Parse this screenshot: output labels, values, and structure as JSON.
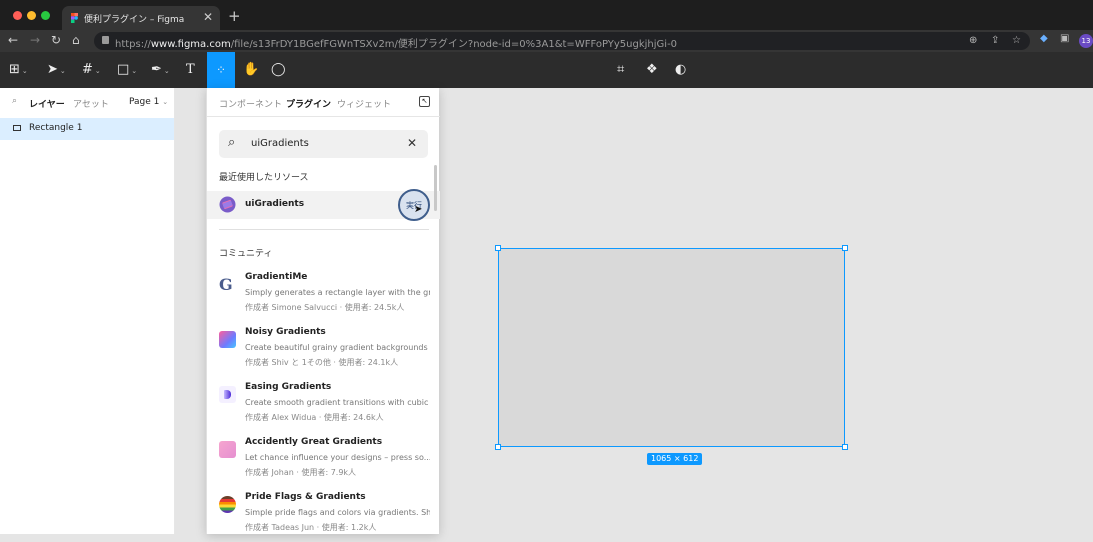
{
  "browser": {
    "tab_title": "便利プラグイン – Figma",
    "new_tab": "+",
    "tab_close": "✕",
    "url_prefix": "https://",
    "url_host": "www.figma.com",
    "url_path": "/file/s13FrDY1BGefFGWnTSXv2m/便利プラグイン?node-id=0%3A1&t=WFFoPYy5ugkjhjGi-0",
    "extension_badge": "13"
  },
  "toolbar": {
    "text_tool": "T"
  },
  "left_panel": {
    "tabs": [
      "レイヤー",
      "アセット"
    ],
    "page_selector": "Page 1",
    "layers": [
      {
        "name": "Rectangle 1"
      }
    ]
  },
  "resources": {
    "tabs": [
      "コンポーネント",
      "プラグイン",
      "ウィジェット"
    ],
    "active_tab": "プラグイン",
    "search_value": "uiGradients",
    "recent_heading": "最近使用したリソース",
    "recent_item": {
      "name": "uiGradients",
      "run_label": "実行"
    },
    "community_heading": "コミュニティ",
    "plugins": [
      {
        "name": "GradientiMe",
        "description": "Simply generates a rectangle layer with the gr...",
        "author": "作成者 Simone Salvucci · 使用者: 24.5k人"
      },
      {
        "name": "Noisy Gradients",
        "description": "Create beautiful grainy gradient backgrounds",
        "author": "作成者 Shiv と 1その他 · 使用者: 24.1k人"
      },
      {
        "name": "Easing Gradients",
        "description": "Create smooth gradient transitions with cubic ...",
        "author": "作成者 Alex Widua · 使用者: 24.6k人"
      },
      {
        "name": "Accidently Great Gradients",
        "description": "Let chance influence your designs – press so...",
        "author": "作成者 Johan · 使用者: 7.9k人"
      },
      {
        "name": "Pride Flags & Gradients",
        "description": "Simple pride flags and colors via gradients. Sh...",
        "author": "作成者 Tadeas Jun · 使用者: 1.2k人"
      }
    ]
  },
  "canvas": {
    "selection_size": "1065 × 612"
  },
  "colors": {
    "accent": "#0d99ff",
    "toolbar_bg": "#2c2c2c"
  }
}
